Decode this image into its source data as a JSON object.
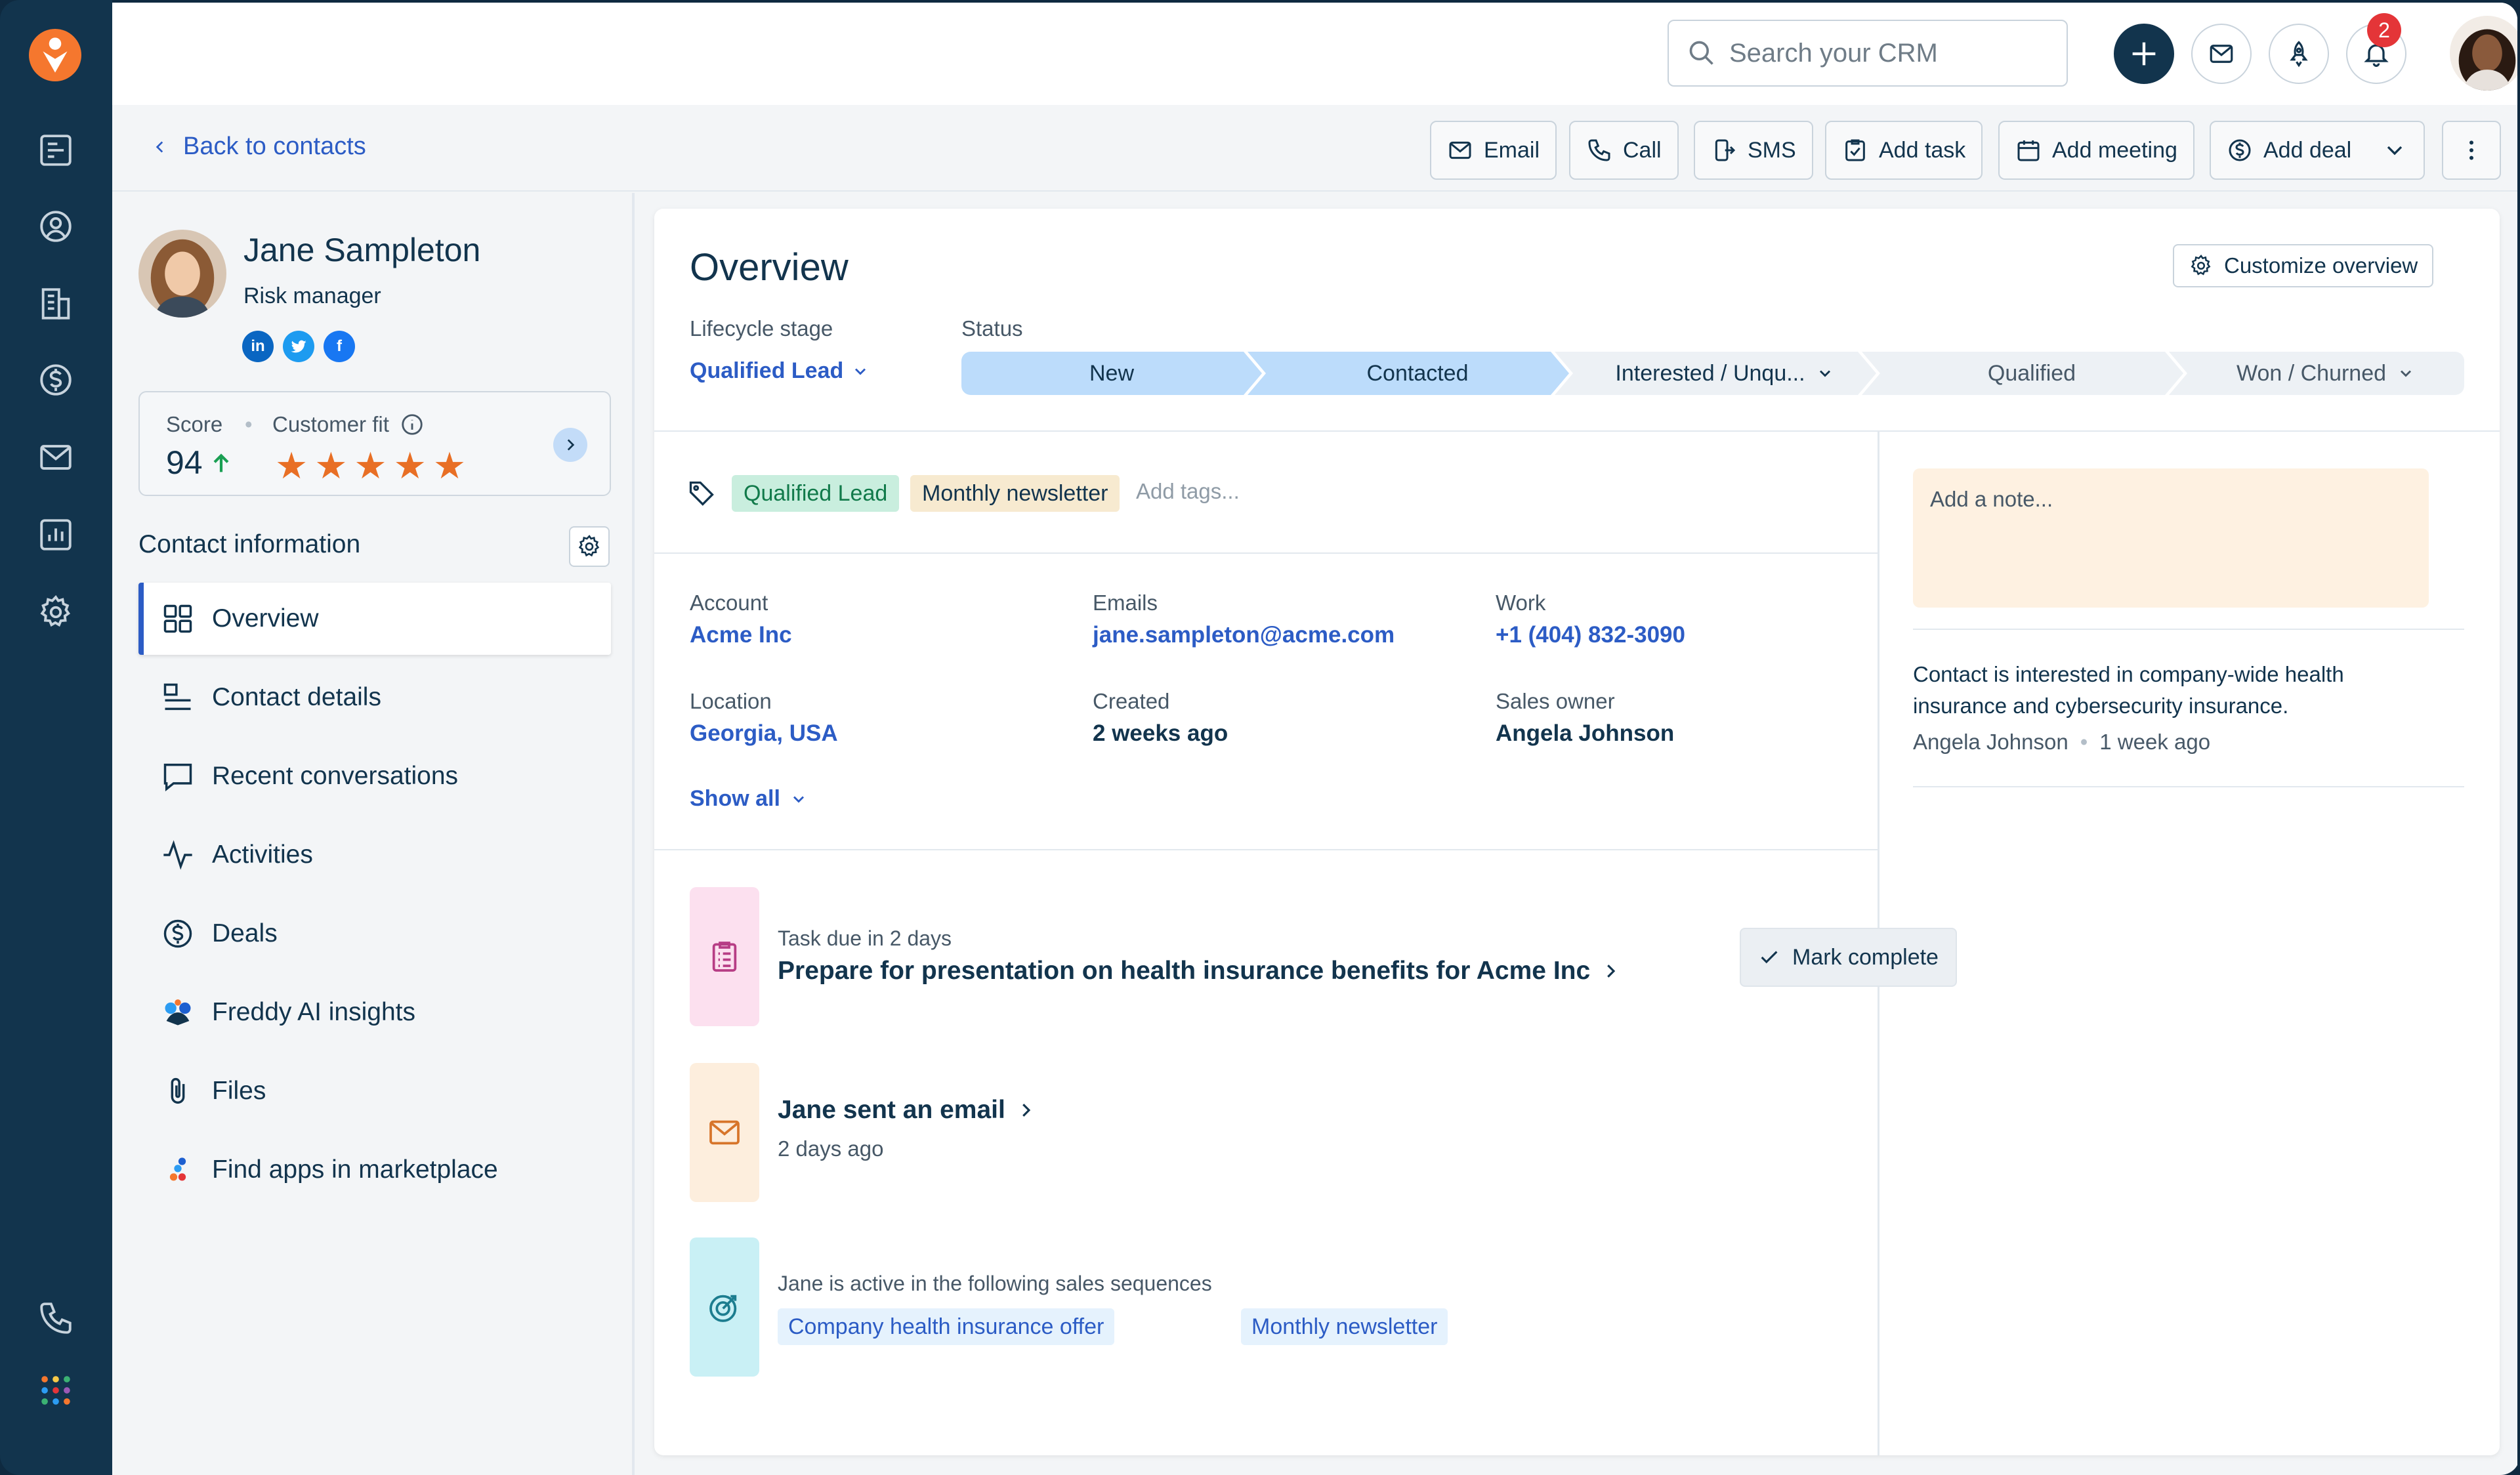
{
  "topbar": {
    "search_placeholder": "Search your CRM",
    "notifications_count": "2"
  },
  "subbar": {
    "back_label": "Back to contacts",
    "actions": [
      "Email",
      "Call",
      "SMS",
      "Add task",
      "Add meeting",
      "Add deal"
    ]
  },
  "contact": {
    "name": "Jane Sampleton",
    "role": "Risk manager",
    "score_label": "Score",
    "score": "94",
    "fit_label": "Customer fit",
    "fit_stars": 5
  },
  "sidebar": {
    "section_title": "Contact information",
    "items": [
      {
        "label": "Overview",
        "icon": "grid-icon"
      },
      {
        "label": "Contact details",
        "icon": "details-icon"
      },
      {
        "label": "Recent conversations",
        "icon": "chat-icon"
      },
      {
        "label": "Activities",
        "icon": "activity-icon"
      },
      {
        "label": "Deals",
        "icon": "dollar-icon"
      },
      {
        "label": "Freddy AI insights",
        "icon": "freddy-icon"
      },
      {
        "label": "Files",
        "icon": "paperclip-icon"
      },
      {
        "label": "Find apps in marketplace",
        "icon": "marketplace-icon"
      }
    ]
  },
  "overview": {
    "title": "Overview",
    "customize_label": "Customize overview",
    "lifecycle_label": "Lifecycle stage",
    "lifecycle_value": "Qualified Lead",
    "status_label": "Status",
    "stages": [
      "New",
      "Contacted",
      "Interested / Unqu...",
      "Qualified",
      "Won / Churned"
    ],
    "tags": [
      "Qualified Lead",
      "Monthly newsletter"
    ],
    "add_tags_placeholder": "Add tags...",
    "fields": {
      "account_label": "Account",
      "account": "Acme Inc",
      "emails_label": "Emails",
      "email": "jane.sampleton@acme.com",
      "work_label": "Work",
      "work": "+1 (404) 832-3090",
      "location_label": "Location",
      "location": "Georgia, USA",
      "created_label": "Created",
      "created": "2 weeks ago",
      "owner_label": "Sales owner",
      "owner": "Angela Johnson"
    },
    "show_all": "Show all",
    "activities": {
      "task_sub": "Task due in 2 days",
      "task_title": "Prepare for presentation on health insurance benefits for Acme Inc",
      "mark_complete": "Mark complete",
      "email_title": "Jane sent an email",
      "email_sub": "2 days ago",
      "seq_sub": "Jane is active in the following sales sequences",
      "sequences": [
        "Company health insurance offer",
        "Monthly newsletter"
      ]
    }
  },
  "notes": {
    "placeholder": "Add a note...",
    "text": "Contact is interested in company-wide health insurance and cybersecurity insurance.",
    "author": "Angela Johnson",
    "time": "1 week ago"
  },
  "colors": {
    "rail": "#12344d",
    "accent": "#2c5cc5",
    "logo": "#f5772e",
    "stage_done": "#bcdcfb",
    "star": "#e86f25"
  }
}
